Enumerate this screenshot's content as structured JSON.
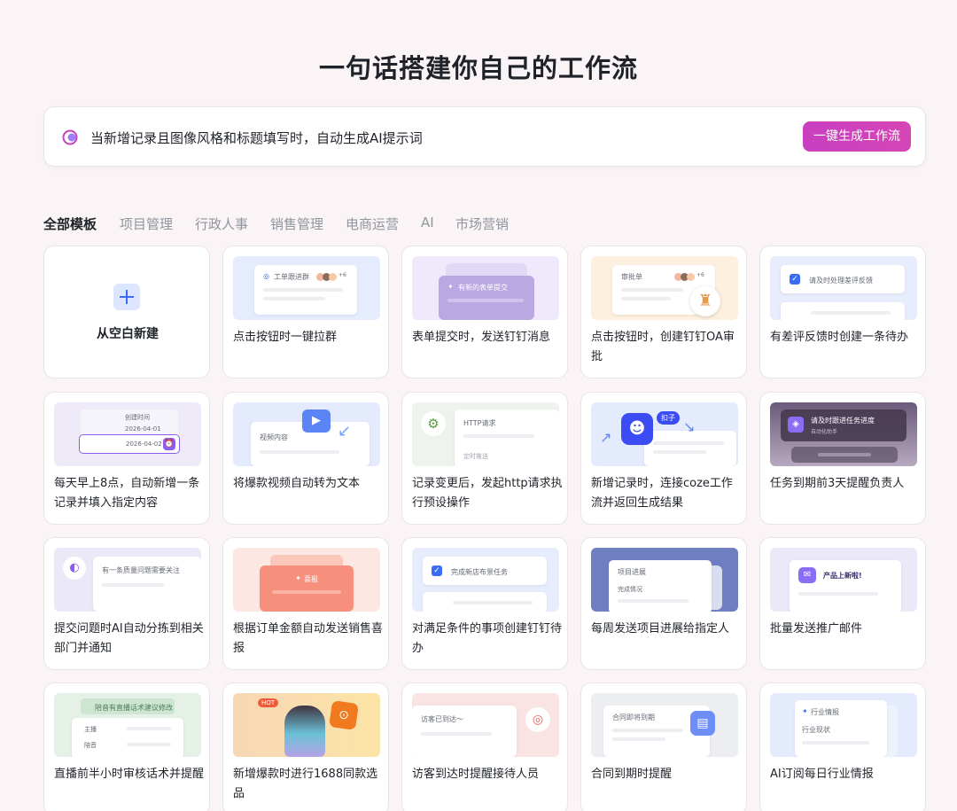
{
  "page": {
    "title": "一句话搭建你自己的工作流"
  },
  "prompt": {
    "text": "当新增记录且图像风格和标题填写时，自动生成AI提示词",
    "button": "一键生成工作流"
  },
  "tabs": [
    "全部模板",
    "项目管理",
    "行政人事",
    "销售管理",
    "电商运营",
    "AI",
    "市场营销"
  ],
  "blank": {
    "label": "从空白新建"
  },
  "cards": [
    {
      "label": "点击按钮时一键拉群",
      "thumb_text": "工单跟进群",
      "thumb_badge": "+6"
    },
    {
      "label": "表单提交时，发送钉钉消息",
      "thumb_text": "有新的表单提交"
    },
    {
      "label": "点击按钮时，创建钉钉OA审批",
      "thumb_text": "审批单",
      "thumb_badge": "+6"
    },
    {
      "label": "有差评反馈时创建一条待办",
      "thumb_text": "请及时处理差评反馈"
    },
    {
      "label": "每天早上8点，自动新增一条记录并填入指定内容",
      "thumb_text": "创建时间",
      "thumb_date1": "2026-04-01",
      "thumb_date2": "2026-04-02"
    },
    {
      "label": "将爆款视频自动转为文本",
      "thumb_text": "视频内容"
    },
    {
      "label": "记录变更后，发起http请求执行预设操作",
      "thumb_text": "HTTP请求",
      "thumb_sub": "定时推送"
    },
    {
      "label": "新增记录时，连接coze工作流并返回生成结果",
      "thumb_text": "扣子"
    },
    {
      "label": "任务到期前3天提醒负责人",
      "thumb_text": "请及时跟进任务进度",
      "thumb_sub": "自动化助手"
    },
    {
      "label": "提交问题时AI自动分拣到相关部门并通知",
      "thumb_text": "有一条质量问题需要关注"
    },
    {
      "label": "根据订单金额自动发送销售喜报",
      "thumb_text": "喜报"
    },
    {
      "label": "对满足条件的事项创建钉钉待办",
      "thumb_text": "完成新店布景任务"
    },
    {
      "label": "每周发送项目进展给指定人",
      "thumb_text": "项目进展",
      "thumb_sub": "完成情况"
    },
    {
      "label": "批量发送推广邮件",
      "thumb_text": "产品上新啦!"
    },
    {
      "label": "直播前半小时审核话术并提醒",
      "thumb_text": "陪音有直播话术建议修改",
      "thumb_r1": "主播",
      "thumb_r2": "陪音"
    },
    {
      "label": "新增爆款时进行1688同款选品",
      "thumb_text": "HOT"
    },
    {
      "label": "访客到达时提醒接待人员",
      "thumb_text": "访客已到达～"
    },
    {
      "label": "合同到期时提醒",
      "thumb_text": "合同即将到期"
    },
    {
      "label": "AI订阅每日行业情报",
      "thumb_text": "行业情报",
      "thumb_sub": "行业现状"
    }
  ],
  "colors": {
    "accent": "#c83fc1",
    "page_bg": "#fbf4f6",
    "blue": "#3b6cf5"
  }
}
